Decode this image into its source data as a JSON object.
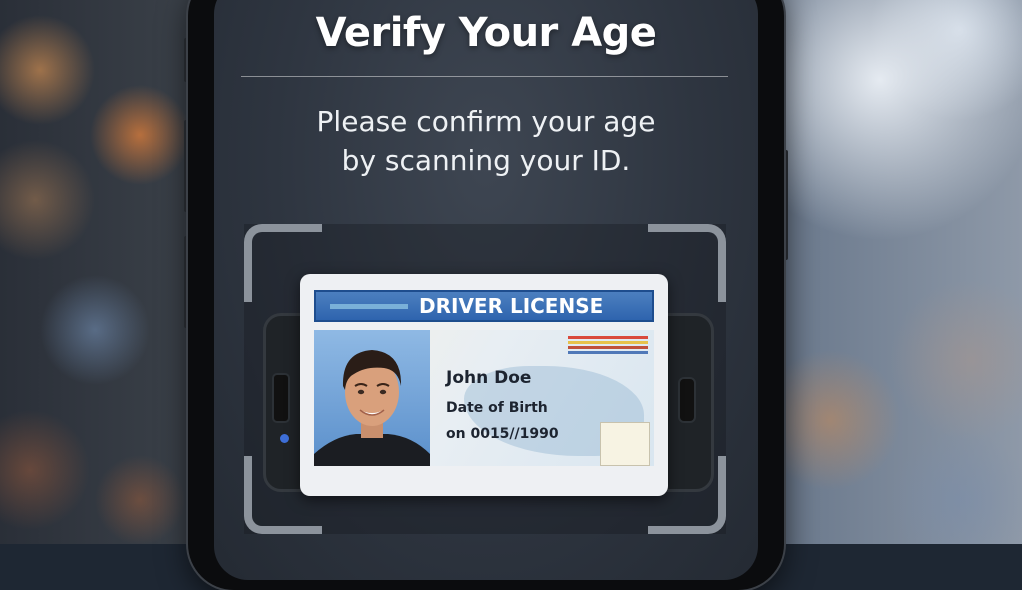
{
  "screen": {
    "title": "Verify Your Age",
    "subtitle_line1": "Please confirm your age",
    "subtitle_line2": "by scanning your ID."
  },
  "license": {
    "header": "DRIVER LICENSE",
    "name": "John Doe",
    "dob_label": "Date of Birth",
    "dob_value": "on 0015//1990"
  },
  "colors": {
    "header_blue": "#2e64ae",
    "indicator_blue": "#3e6fd8"
  }
}
